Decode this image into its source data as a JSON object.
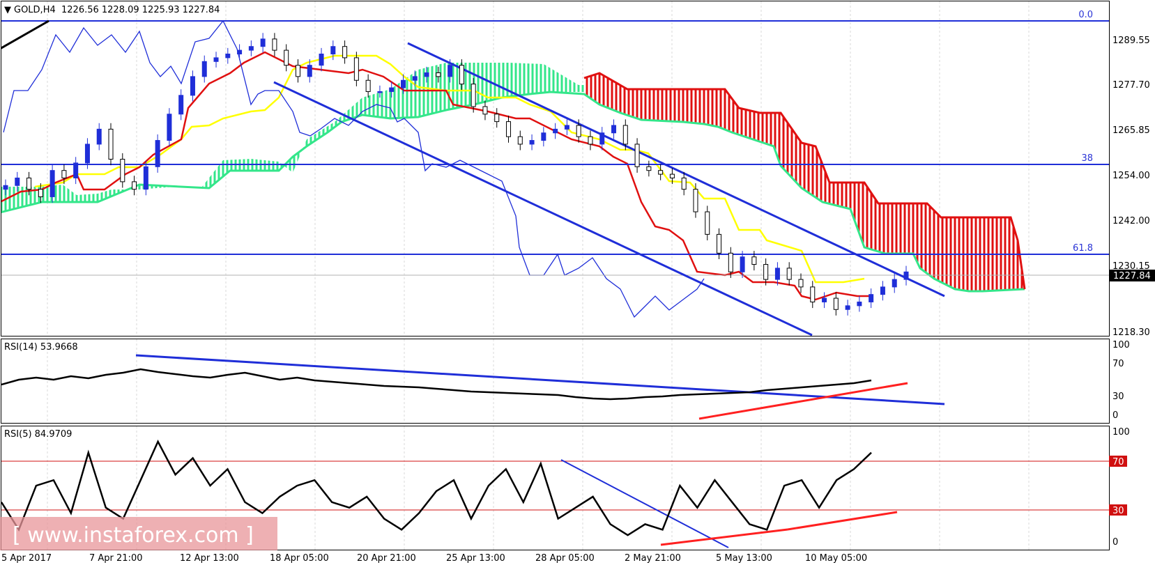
{
  "header": {
    "symbol": "GOLD,H4",
    "ohlc": "1226.56 1228.09 1225.93 1227.84"
  },
  "price_badge": "1227.84",
  "watermark": "[ www.instaforex.com ]",
  "colors": {
    "background": "#ffffff",
    "channel": "#1f2ed8",
    "kijun": "#e01010",
    "tenkan": "#ffff00",
    "chikou": "#1f2ed8",
    "cloud_bull": "#33e68a",
    "cloud_bear": "#e01010",
    "rsi_line": "#000000",
    "divergence": "#ff2020",
    "watermark_bg": "#e8959a"
  },
  "chart_data": [
    {
      "type": "line",
      "name": "price",
      "ylim": [
        1211,
        1300
      ],
      "y_ticks": [
        "1289.55",
        "1277.70",
        "1265.85",
        "1254.00",
        "1242.00",
        "1230.15",
        "1218.30"
      ],
      "x_ticks": [
        "5 Apr 2017",
        "7 Apr 21:00",
        "12 Apr 13:00",
        "18 Apr 05:00",
        "20 Apr 21:00",
        "25 Apr 13:00",
        "28 Apr 05:00",
        "2 May 21:00",
        "5 May 13:00",
        "10 May 05:00"
      ],
      "fib_levels": [
        {
          "label": "0.0",
          "value": 1295
        },
        {
          "label": "38",
          "value": 1257.5
        },
        {
          "label": "61.8",
          "value": 1234
        }
      ],
      "series": [
        {
          "values": [
            1251,
            1253,
            1250,
            1248,
            1255,
            1253,
            1257,
            1262,
            1266,
            1258,
            1252,
            1250,
            1256,
            1263,
            1270,
            1275,
            1280,
            1284,
            1285,
            1286,
            1287,
            1288,
            1290,
            1287,
            1283,
            1280,
            1283,
            1286,
            1288,
            1285,
            1279,
            1276,
            1276,
            1277,
            1279,
            1280,
            1281,
            1280,
            1283,
            1278,
            1272,
            1270,
            1268,
            1264,
            1262,
            1263,
            1265,
            1266,
            1267,
            1264,
            1262,
            1265,
            1267,
            1262,
            1256,
            1255,
            1254,
            1253,
            1250,
            1244,
            1238,
            1233,
            1228,
            1232,
            1230,
            1226,
            1229,
            1226,
            1224,
            1220,
            1221,
            1218,
            1219,
            1220,
            1222,
            1224,
            1226,
            1228
          ]
        }
      ]
    },
    {
      "type": "line",
      "name": "RSI(14)",
      "title": "RSI(14) 53.9668",
      "ylim": [
        0,
        100
      ],
      "y_ticks": [
        "100",
        "70",
        "30",
        "0"
      ],
      "series": [
        {
          "values": [
            48,
            55,
            58,
            55,
            60,
            57,
            62,
            65,
            70,
            66,
            63,
            60,
            58,
            62,
            65,
            60,
            55,
            58,
            54,
            52,
            50,
            48,
            46,
            45,
            44,
            42,
            40,
            38,
            37,
            36,
            35,
            34,
            33,
            30,
            28,
            27,
            28,
            30,
            31,
            33,
            34,
            35,
            36,
            37,
            40,
            42,
            44,
            46,
            48,
            50,
            54
          ]
        }
      ]
    },
    {
      "type": "line",
      "name": "RSI(5)",
      "title": "RSI(5) 84.9709",
      "ylim": [
        0,
        100
      ],
      "y_ticks": [
        "100",
        "70",
        "30",
        "0"
      ],
      "series": [
        {
          "values": [
            40,
            15,
            55,
            60,
            30,
            85,
            35,
            25,
            60,
            95,
            65,
            80,
            55,
            70,
            40,
            30,
            45,
            55,
            60,
            40,
            35,
            45,
            25,
            15,
            30,
            50,
            60,
            25,
            55,
            70,
            40,
            75,
            25,
            35,
            45,
            20,
            10,
            20,
            15,
            55,
            35,
            60,
            40,
            20,
            15,
            55,
            60,
            35,
            60,
            70,
            85
          ]
        }
      ]
    }
  ]
}
